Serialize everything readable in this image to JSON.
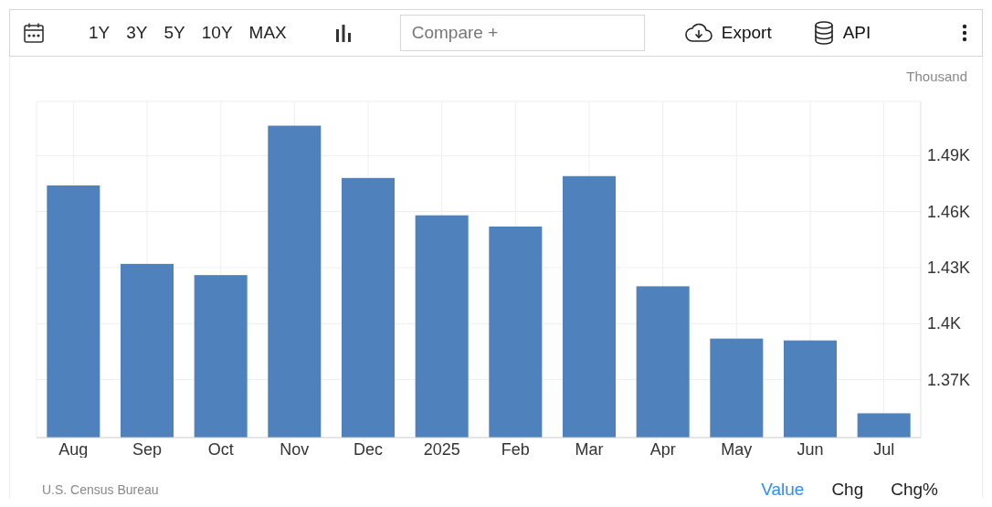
{
  "toolbar": {
    "ranges": [
      {
        "label": "1Y",
        "selected": false
      },
      {
        "label": "3Y",
        "selected": false
      },
      {
        "label": "5Y",
        "selected": false
      },
      {
        "label": "10Y",
        "selected": false
      },
      {
        "label": "MAX",
        "selected": false
      }
    ],
    "compare": {
      "placeholder": "Compare +"
    },
    "export": "Export",
    "api": "API"
  },
  "chart": {
    "unit": "Thousand",
    "chart_data": {
      "type": "bar",
      "categories": [
        "Aug",
        "Sep",
        "Oct",
        "Nov",
        "Dec",
        "2025",
        "Feb",
        "Mar",
        "Apr",
        "May",
        "Jun",
        "Jul"
      ],
      "grid": true,
      "series": [
        {
          "color": "#4f81bd",
          "values": [
            1.474,
            1.432,
            1.426,
            1.506,
            1.478,
            1.458,
            1.452,
            1.479,
            1.42,
            1.392,
            1.391,
            1.352
          ]
        }
      ],
      "ylim": [
        1.339,
        1.519
      ],
      "yticks": [
        {
          "value": 1.37,
          "label": "1.37K"
        },
        {
          "value": 1.4,
          "label": "1.4K"
        },
        {
          "value": 1.43,
          "label": "1.43K"
        },
        {
          "value": 1.46,
          "label": "1.46K"
        },
        {
          "value": 1.49,
          "label": "1.49K"
        }
      ]
    }
  },
  "footer": {
    "source": "U.S. Census Bureau",
    "views": [
      {
        "label": "Value",
        "selected": true
      },
      {
        "label": "Chg",
        "selected": false
      },
      {
        "label": "Chg%",
        "selected": false
      }
    ]
  }
}
